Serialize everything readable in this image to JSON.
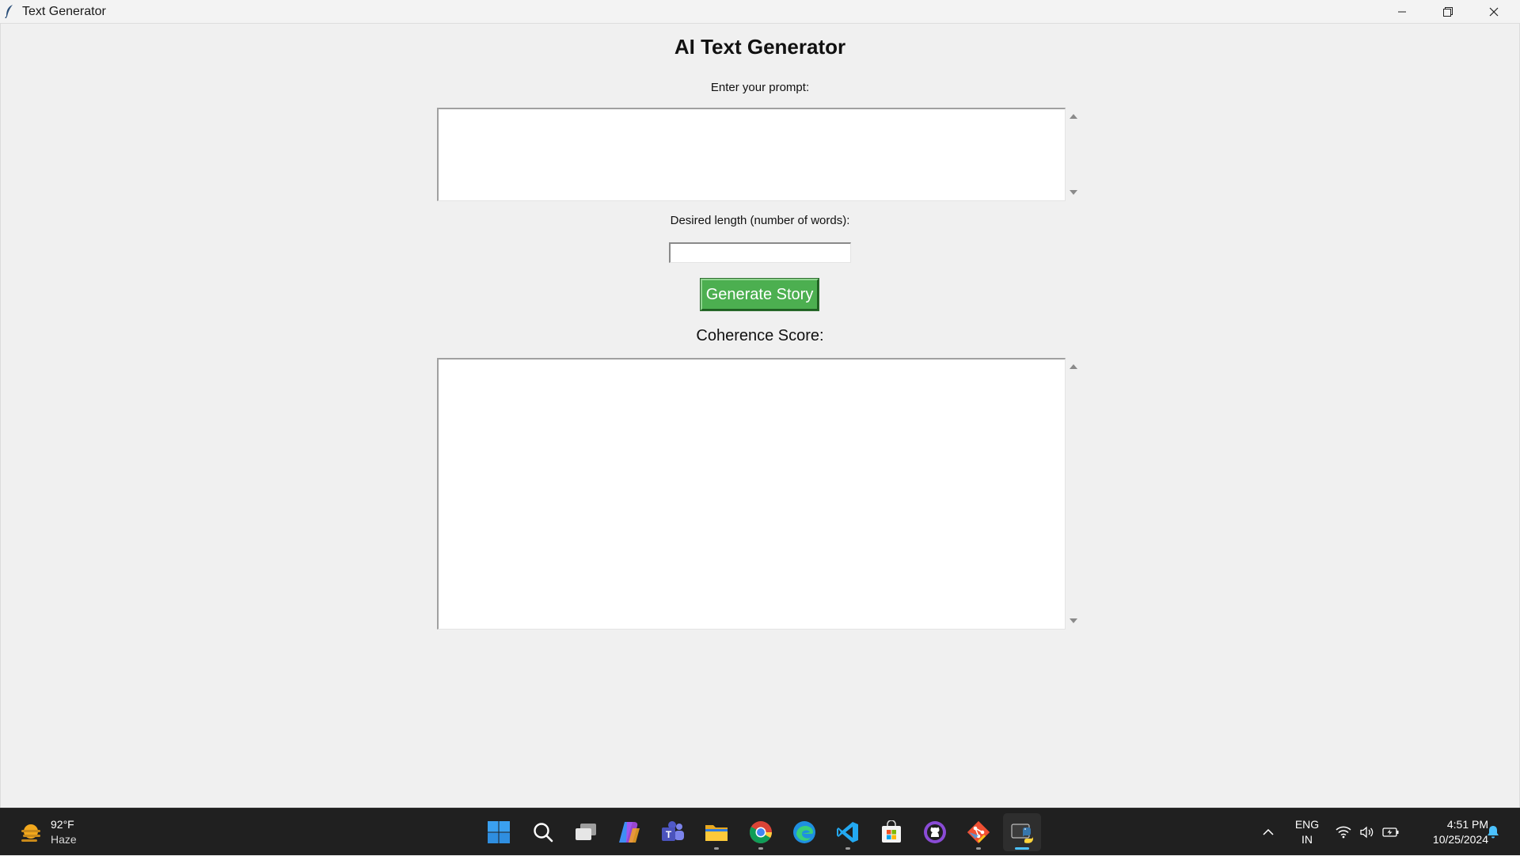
{
  "window": {
    "title": "Text Generator"
  },
  "app": {
    "heading": "AI Text Generator",
    "prompt_label": "Enter your prompt:",
    "prompt_value": "",
    "length_label": "Desired length (number of words):",
    "length_value": "",
    "generate_button": "Generate Story",
    "coherence_label": "Coherence Score:",
    "output_value": "",
    "button_color": "#4caf50"
  },
  "taskbar": {
    "weather": {
      "temperature": "92°F",
      "condition": "Haze",
      "icon": "weather-haze-icon"
    },
    "apps": [
      {
        "name": "start",
        "icon": "windows-start-icon"
      },
      {
        "name": "search",
        "icon": "search-icon"
      },
      {
        "name": "task-view",
        "icon": "task-view-icon"
      },
      {
        "name": "copilot",
        "icon": "copilot-icon"
      },
      {
        "name": "teams",
        "icon": "teams-icon"
      },
      {
        "name": "file-explorer",
        "icon": "folder-icon"
      },
      {
        "name": "chrome",
        "icon": "chrome-icon"
      },
      {
        "name": "edge",
        "icon": "edge-icon"
      },
      {
        "name": "vscode",
        "icon": "vscode-icon"
      },
      {
        "name": "microsoft-store",
        "icon": "store-icon"
      },
      {
        "name": "github-desktop",
        "icon": "github-icon"
      },
      {
        "name": "git",
        "icon": "git-icon"
      },
      {
        "name": "python",
        "icon": "python-icon"
      }
    ],
    "tray": {
      "language_line1": "ENG",
      "language_line2": "IN",
      "time": "4:51 PM",
      "date": "10/25/2024"
    }
  }
}
